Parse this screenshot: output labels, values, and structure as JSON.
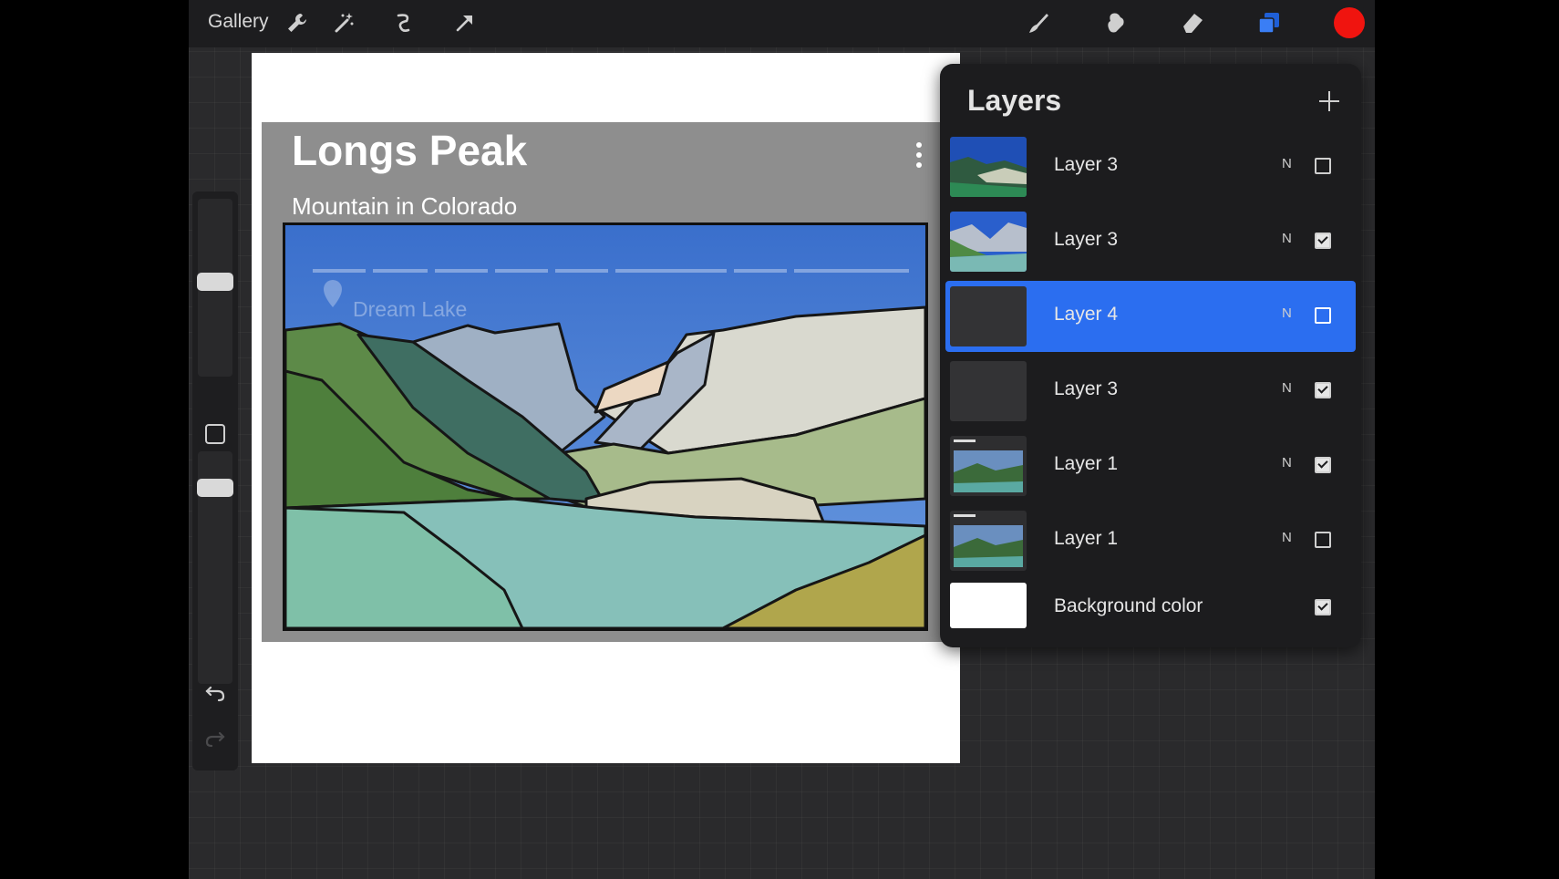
{
  "toolbar": {
    "gallery_label": "Gallery",
    "left_tools": [
      "wrench-icon",
      "magic-wand-icon",
      "selection-icon",
      "transform-icon"
    ],
    "right_tools": [
      "brush-icon",
      "smudge-icon",
      "eraser-icon",
      "layers-icon"
    ],
    "current_color": "#f0140f"
  },
  "canvas": {
    "card": {
      "title": "Longs Peak",
      "subtitle": "Mountain in Colorado",
      "location_label": "Dream Lake"
    }
  },
  "layers_panel": {
    "title": "Layers",
    "layers": [
      {
        "name": "Layer 3",
        "blend": "N",
        "visible": false,
        "active": false
      },
      {
        "name": "Layer 3",
        "blend": "N",
        "visible": true,
        "active": false
      },
      {
        "name": "Layer 4",
        "blend": "N",
        "visible": false,
        "active": true
      },
      {
        "name": "Layer 3",
        "blend": "N",
        "visible": true,
        "active": false
      },
      {
        "name": "Layer 1",
        "blend": "N",
        "visible": true,
        "active": false
      },
      {
        "name": "Layer 1",
        "blend": "N",
        "visible": false,
        "active": false
      }
    ],
    "background": {
      "name": "Background color",
      "visible": true
    }
  },
  "colors": {
    "accent": "#2b6ef0",
    "toolbar_bg": "#1d1d1f",
    "panel_bg": "#1c1c1e"
  }
}
